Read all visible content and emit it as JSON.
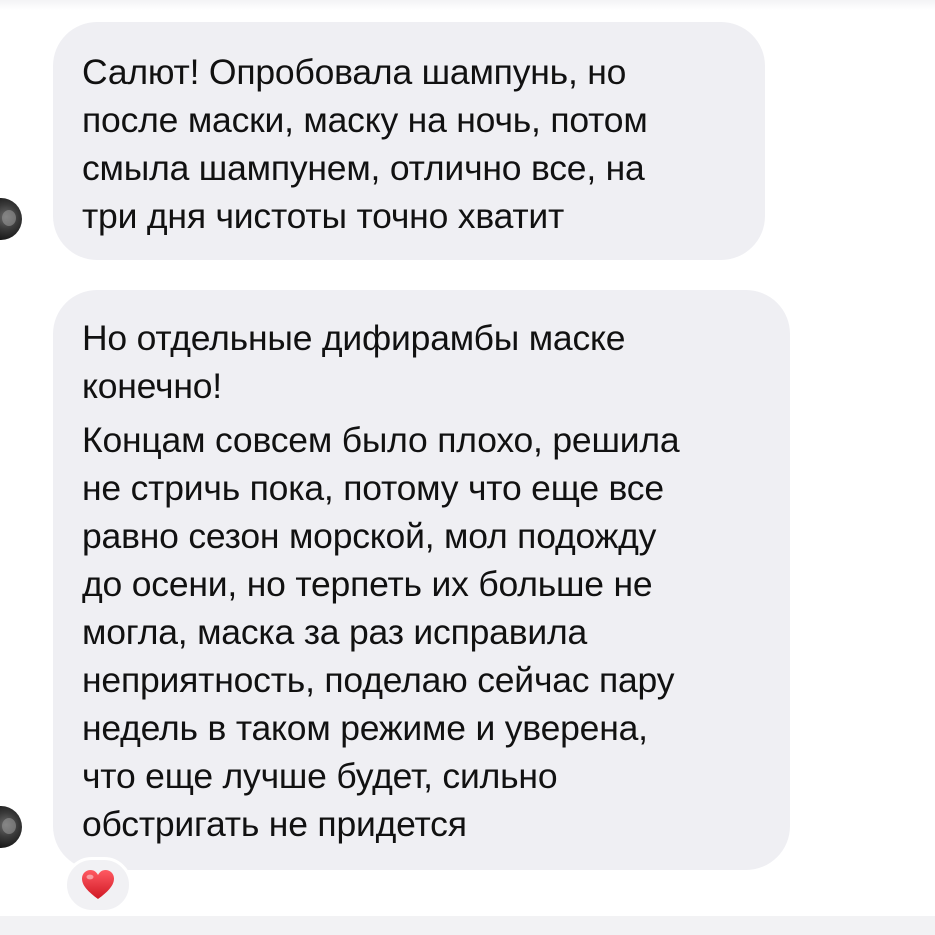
{
  "messages": [
    {
      "lines": [
        "Салют! Опробовала шампунь, но",
        "после маски, маску на ночь, потом",
        "смыла шампунем, отлично все, на",
        "три дня чистоты точно хватит"
      ]
    },
    {
      "paragraph1": [
        "Но отдельные дифирамбы маске",
        "конечно!"
      ],
      "paragraph2": [
        "Концам совсем было плохо, решила",
        "не стричь пока, потому что еще все",
        "равно сезон морской, мол подожду",
        "до осени, но терпеть их больше не",
        "могла, маска за раз исправила",
        "неприятность, поделаю сейчас пару",
        "недель в таком режиме и уверена,",
        "что еще лучше будет, сильно",
        "обстригать не придется"
      ],
      "reaction": {
        "icon": "heart-icon",
        "color": "#e0242f"
      }
    }
  ],
  "colors": {
    "bubble": "#efeff3",
    "text": "#111111",
    "background": "#ffffff"
  }
}
